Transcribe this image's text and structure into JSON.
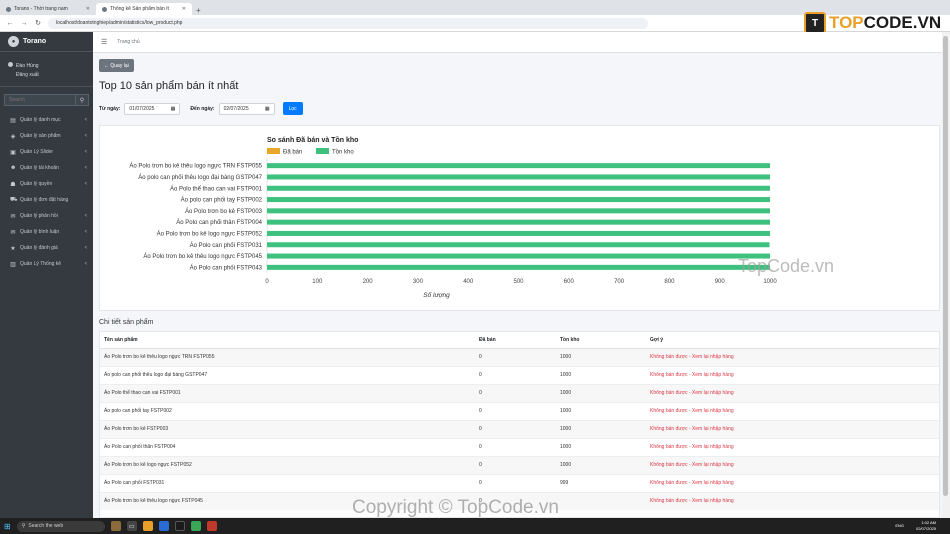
{
  "browser": {
    "tabs": [
      {
        "label": "Torano - Thời trang nam",
        "active": false
      },
      {
        "label": "Thống kê Sản phẩm bán ít",
        "active": true
      }
    ],
    "new_tab": "+",
    "url": "localhost/doantotnghiep/admin/statistics/low_product.php"
  },
  "sidebar": {
    "brand": "Torano",
    "user_name": "Đào Hùng",
    "logout": "Đăng xuất",
    "search_placeholder": "Search",
    "items": [
      {
        "label": "Quản lý danh mục",
        "icon": "list-icon",
        "has_children": true
      },
      {
        "label": "Quản lý sản phẩm",
        "icon": "cube-icon",
        "has_children": true
      },
      {
        "label": "Quản Lý Slider",
        "icon": "slider-icon",
        "has_children": true
      },
      {
        "label": "Quản lý tài khoản",
        "icon": "users-icon",
        "has_children": true
      },
      {
        "label": "Quản lý quyền",
        "icon": "user-shield-icon",
        "has_children": true
      },
      {
        "label": "Quản lý đơn đặt hàng",
        "icon": "cart-icon",
        "has_children": false
      },
      {
        "label": "Quản lý phản hồi",
        "icon": "comment-icon",
        "has_children": true
      },
      {
        "label": "Quản lý bình luận",
        "icon": "comments-icon",
        "has_children": true
      },
      {
        "label": "Quản lý đánh giá",
        "icon": "star-icon",
        "has_children": true
      },
      {
        "label": "Quản Lý Thống kê",
        "icon": "chart-icon",
        "has_children": true
      }
    ]
  },
  "topbar": {
    "home": "Trang chủ"
  },
  "page": {
    "back_label": "← Quay lại",
    "title": "Top 10 sản phẩm bán ít nhất",
    "from_label": "Từ ngày:",
    "from_value": "01/07/2025",
    "to_label": "Đến ngày:",
    "to_value": "02/07/2025",
    "filter_label": "Lọc",
    "detail_title": "Chi tiết sản phẩm"
  },
  "chart_data": {
    "type": "bar",
    "orientation": "horizontal",
    "stacked": true,
    "title": "So sánh Đã bán và Tồn kho",
    "xlabel": "Số lượng",
    "ylabel": "",
    "xlim": [
      0,
      1000
    ],
    "x_ticks": [
      0,
      100,
      200,
      300,
      400,
      500,
      600,
      700,
      800,
      900,
      1000
    ],
    "grid": false,
    "legend_position": "top-left",
    "categories": [
      "Áo Polo trơn bo kẻ thêu logo ngực TRN FSTP055",
      "Áo polo can phối thêu logo đại bàng GSTP047",
      "Áo Polo thể thao can vai FSTP001",
      "Áo polo can phối tay FSTP002",
      "Áo Polo trơn bo kẻ FSTP003",
      "Áo Polo can phối thân FSTP004",
      "Áo Polo trơn bo kẻ logo ngực FSTP052",
      "Áo Polo can phối FSTP031",
      "Áo Polo trơn bo kẻ thêu logo ngực FSTP045",
      "Áo Polo can phối FSTP043"
    ],
    "series": [
      {
        "name": "Đã bán",
        "color": "#e8a62b",
        "values": [
          0,
          0,
          0,
          0,
          0,
          0,
          0,
          0,
          0,
          0
        ]
      },
      {
        "name": "Tồn kho",
        "color": "#3ec07f",
        "values": [
          1000,
          1000,
          1000,
          1000,
          1000,
          1000,
          1000,
          999,
          1000,
          1000
        ]
      }
    ]
  },
  "table": {
    "headers": [
      "Tên sản phẩm",
      "Đã bán",
      "Tồn kho",
      "Gợi ý"
    ],
    "rows": [
      [
        "Áo Polo trơn bo kẻ thêu logo ngực TRN FSTP055",
        "0",
        "1000",
        "Không bán được - Xem lại nhập hàng"
      ],
      [
        "Áo polo can phối thêu logo đại bàng GSTP047",
        "0",
        "1000",
        "Không bán được - Xem lại nhập hàng"
      ],
      [
        "Áo Polo thể thao can vai FSTP001",
        "0",
        "1000",
        "Không bán được - Xem lại nhập hàng"
      ],
      [
        "Áo polo can phối tay FSTP002",
        "0",
        "1000",
        "Không bán được - Xem lại nhập hàng"
      ],
      [
        "Áo Polo trơn bo kẻ FSTP003",
        "0",
        "1000",
        "Không bán được - Xem lại nhập hàng"
      ],
      [
        "Áo Polo can phối thân FSTP004",
        "0",
        "1000",
        "Không bán được - Xem lại nhập hàng"
      ],
      [
        "Áo Polo trơn bo kẻ logo ngực FSTP052",
        "0",
        "1000",
        "Không bán được - Xem lại nhập hàng"
      ],
      [
        "Áo Polo can phối FSTP031",
        "0",
        "999",
        "Không bán được - Xem lại nhập hàng"
      ],
      [
        "Áo Polo trơn bo kẻ thêu logo ngực FSTP045",
        "0",
        "",
        "Không bán được - Xem lại nhập hàng"
      ]
    ]
  },
  "taskbar": {
    "search_placeholder": "Search the web",
    "time": "1:02 AM",
    "date": "02/07/2025",
    "lang": "ENG"
  },
  "watermark": {
    "logo_prefix": "TOP",
    "logo_suffix": "CODE.VN",
    "logo_mark": "T",
    "mid": "TopCode.vn",
    "bottom": "Copyright © TopCode.vn"
  }
}
